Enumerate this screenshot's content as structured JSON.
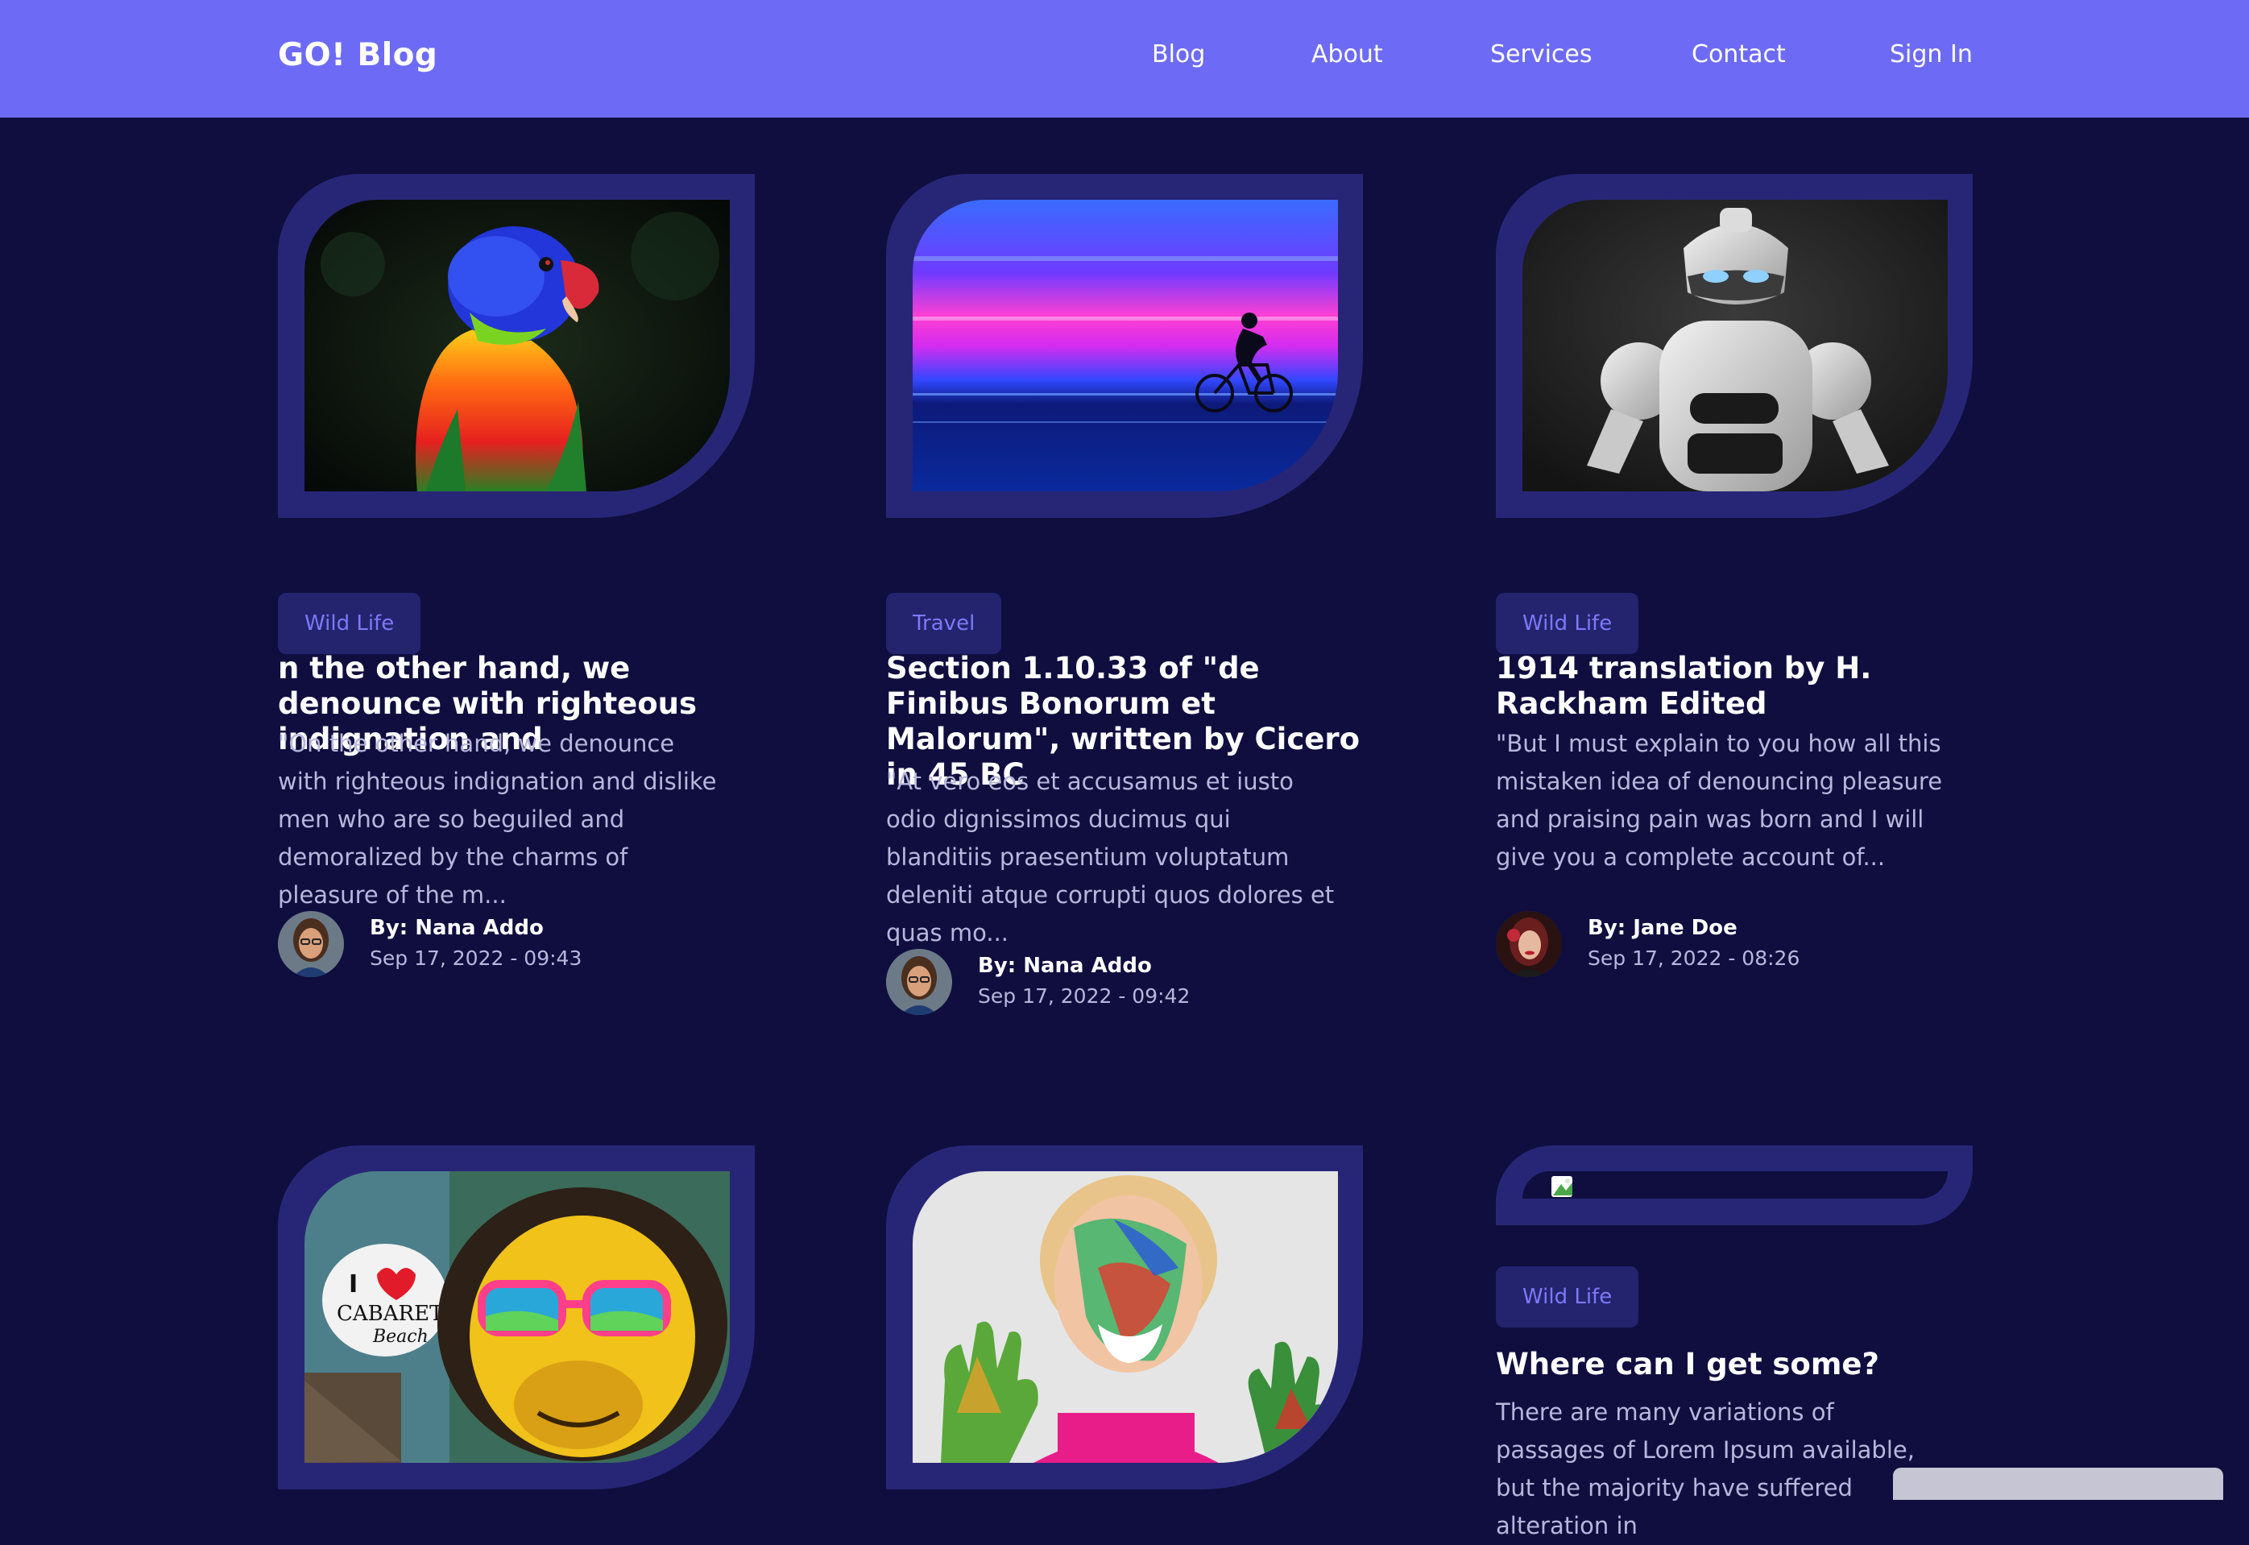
{
  "header": {
    "brand": "GO! Blog",
    "nav": [
      "Blog",
      "About",
      "Services",
      "Contact",
      "Sign In"
    ]
  },
  "colors": {
    "header_bg": "#6d6bf5",
    "page_bg": "#0f0e3f",
    "frame": "#272676",
    "tag_bg": "#24236e",
    "tag_text": "#7c7af8"
  },
  "posts": [
    {
      "image": "rainbow-lorikeet-photo",
      "category": "Wild Life",
      "title": "n the other hand, we denounce with righteous indignation and",
      "excerpt": "\"On the other hand, we denounce with righteous indignation and dislike men who are so beguiled and demoralized by the charms of pleasure of the m...",
      "author": "By: Nana Addo",
      "date": "Sep 17, 2022 - 09:43"
    },
    {
      "image": "cyclist-neon-blur-photo",
      "category": "Travel",
      "title": "Section 1.10.33 of \"de Finibus Bonorum et Malorum\", written by Cicero in 45 BC",
      "excerpt": "\"At vero eos et accusamus et iusto odio dignissimos ducimus qui blanditiis praesentium voluptatum deleniti atque corrupti quos dolores et quas mo...",
      "author": "By: Nana Addo",
      "date": "Sep 17, 2022 - 09:42"
    },
    {
      "image": "white-robot-photo",
      "category": "Wild Life",
      "title": "1914 translation by H. Rackham Edited",
      "excerpt": "\"But I must explain to you how all this mistaken idea of denouncing pleasure and praising pain was born and I will give you a complete account of...",
      "author": "By: Jane Doe",
      "date": "Sep 17, 2022 - 08:26"
    },
    {
      "image": "monkey-graffiti-photo",
      "category": "",
      "title": "",
      "excerpt": "",
      "author": "",
      "date": ""
    },
    {
      "image": "painted-child-photo",
      "category": "",
      "title": "",
      "excerpt": "",
      "author": "",
      "date": ""
    },
    {
      "image": "broken-image-icon",
      "category": "Wild Life",
      "title": "Where can I get some?",
      "excerpt": "There are many variations of passages of Lorem Ipsum available, but the majority have suffered alteration in",
      "author": "",
      "date": ""
    }
  ]
}
